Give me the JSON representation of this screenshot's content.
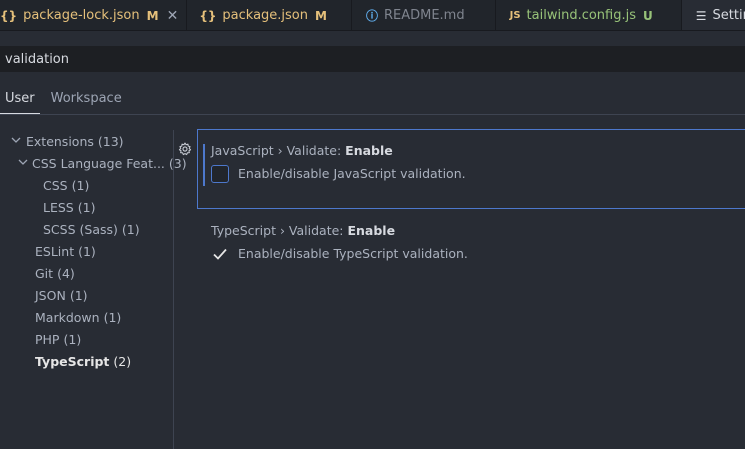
{
  "tabs": [
    {
      "icon": "{}",
      "label": "package-lock.json",
      "status": "M",
      "closable": true
    },
    {
      "icon": "{}",
      "label": "package.json",
      "status": "M"
    },
    {
      "icon": "ⓘ",
      "label": "README.md"
    },
    {
      "icon": "JS",
      "label": "tailwind.config.js",
      "status": "U"
    },
    {
      "icon": "☰",
      "label": "Settings",
      "closable": true
    }
  ],
  "close_glyph": "✕",
  "search": {
    "value": "validation"
  },
  "scope_tabs": [
    "User",
    "Workspace"
  ],
  "tree": [
    {
      "label": "Extensions",
      "count": "(13)"
    },
    {
      "label": "CSS Language Feat...",
      "count": "(3)"
    },
    {
      "label": "CSS",
      "count": "(1)"
    },
    {
      "label": "LESS",
      "count": "(1)"
    },
    {
      "label": "SCSS (Sass)",
      "count": "(1)"
    },
    {
      "label": "ESLint",
      "count": "(1)"
    },
    {
      "label": "Git",
      "count": "(4)"
    },
    {
      "label": "JSON",
      "count": "(1)"
    },
    {
      "label": "Markdown",
      "count": "(1)"
    },
    {
      "label": "PHP",
      "count": "(1)"
    },
    {
      "label": "TypeScript",
      "count": "(2)"
    }
  ],
  "settings": [
    {
      "category": "JavaScript › Validate: ",
      "key": "Enable",
      "description": "Enable/disable JavaScript validation.",
      "checked": false
    },
    {
      "category": "TypeScript › Validate: ",
      "key": "Enable",
      "description": "Enable/disable TypeScript validation.",
      "checked": true
    }
  ],
  "colors": {
    "accent": "#4d78cc",
    "modified": "#e5c07b",
    "untracked": "#98c379"
  }
}
